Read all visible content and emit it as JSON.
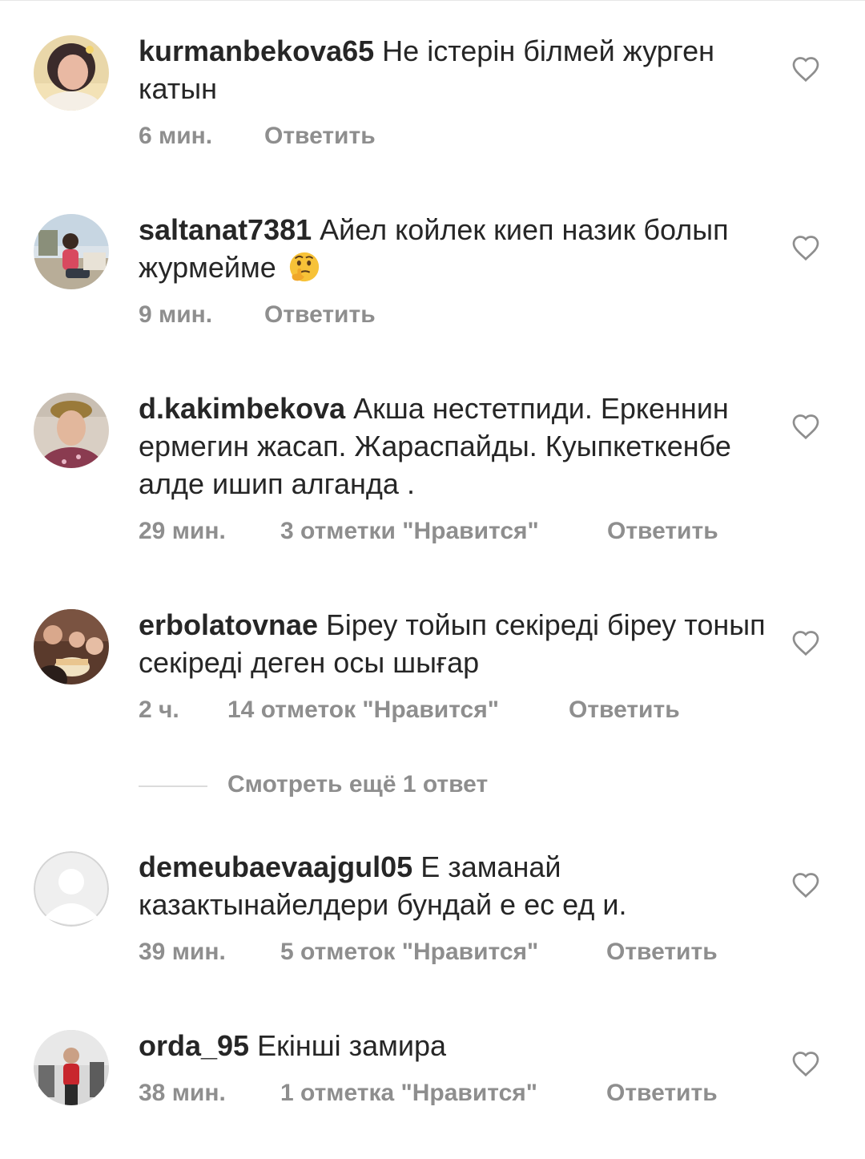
{
  "comments": [
    {
      "username": "kurmanbekova65",
      "text": "Не істерін білмей журген катын",
      "time": "6 мин.",
      "likes": "",
      "reply": "Ответить"
    },
    {
      "username": "saltanat7381",
      "text": "Айел койлек киеп назик болып журмейме",
      "emoji": "thinking-face",
      "time": "9 мин.",
      "likes": "",
      "reply": "Ответить"
    },
    {
      "username": "d.kakimbekova",
      "text": "Акша нестетпиди. Еркеннин ермегин жасап. Жараспайды. Куыпкеткенбе алде ишип алганда .",
      "time": "29 мин.",
      "likes": "3 отметки \"Нравится\"",
      "reply": "Ответить"
    },
    {
      "username": "erbolatovnae",
      "text": "Біреу тойып секіреді біреу тонып секіреді деген осы шығар",
      "time": "2 ч.",
      "likes": "14 отметок \"Нравится\"",
      "reply": "Ответить"
    },
    {
      "username": "demeubaevaajgul05",
      "text": "Е заманай казактынайелдери бундай е ес ед и.",
      "time": "39 мин.",
      "likes": "5 отметок \"Нравится\"",
      "reply": "Ответить"
    },
    {
      "username": "orda_95",
      "text": "Екінші замира",
      "time": "38 мин.",
      "likes": "1 отметка \"Нравится\"",
      "reply": "Ответить"
    }
  ],
  "view_more_replies": "Смотреть ещё 1 ответ",
  "icons": {
    "like": "heart-outline-icon",
    "avatar_placeholder": "default-avatar-icon"
  },
  "colors": {
    "text": "#262626",
    "secondary": "#8e8e8e",
    "divider": "#dbdbdb"
  }
}
